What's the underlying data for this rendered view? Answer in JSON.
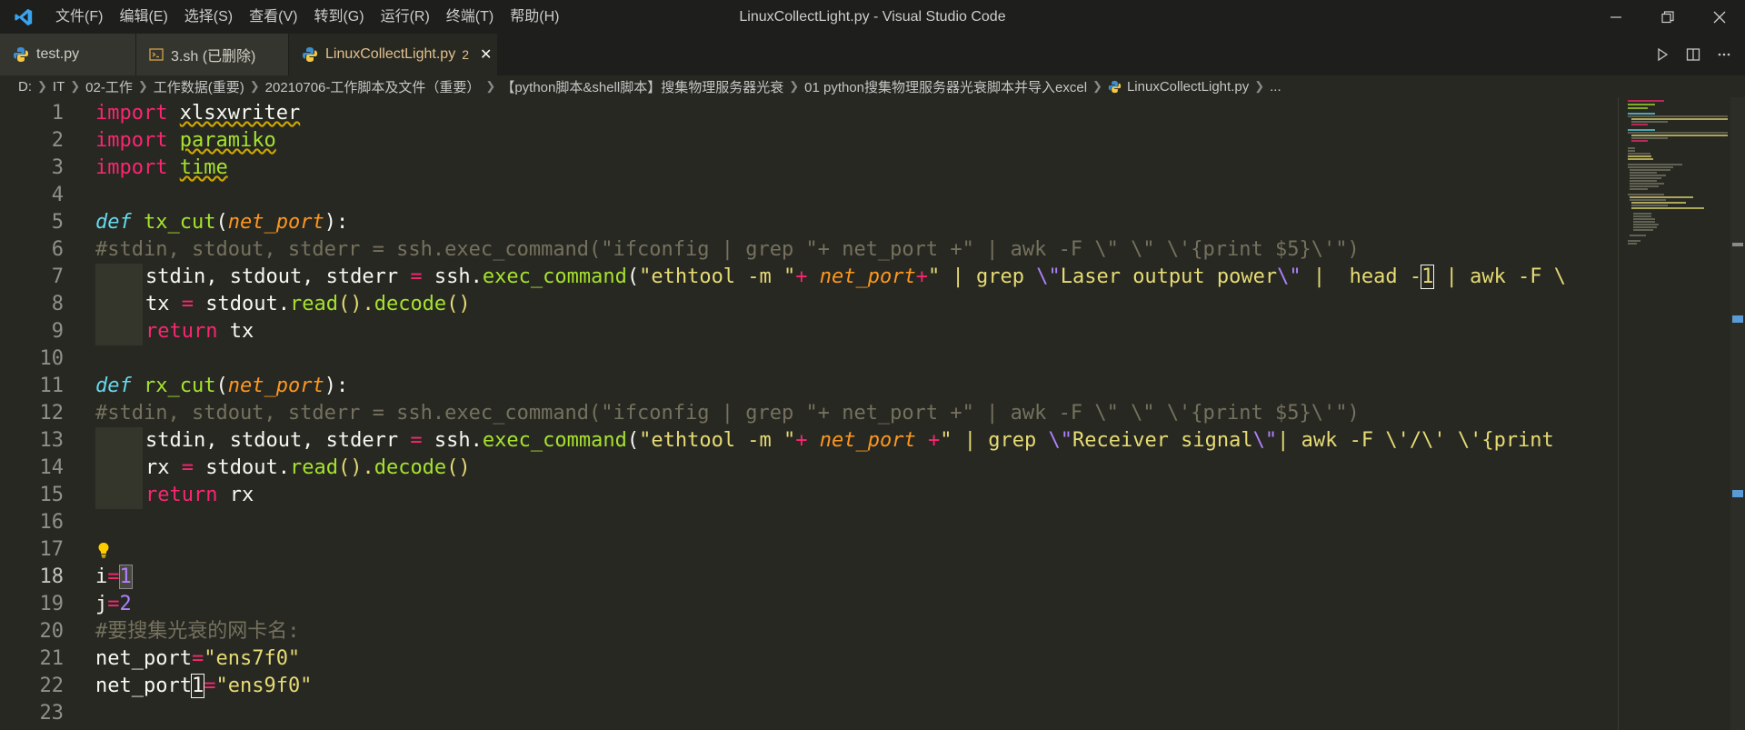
{
  "window": {
    "title": "LinuxCollectLight.py - Visual Studio Code",
    "menu": [
      "文件(F)",
      "编辑(E)",
      "选择(S)",
      "查看(V)",
      "转到(G)",
      "运行(R)",
      "终端(T)",
      "帮助(H)"
    ]
  },
  "tabs": [
    {
      "label": "test.py",
      "icon": "python-icon",
      "active": false
    },
    {
      "label": "3.sh (已删除)",
      "icon": "terminal-icon",
      "active": false
    },
    {
      "label": "LinuxCollectLight.py",
      "icon": "python-icon",
      "active": true,
      "problems": "2"
    }
  ],
  "breadcrumb": [
    "D:",
    "IT",
    "02-工作",
    "工作数据(重要)",
    "20210706-工作脚本及文件（重要）",
    "【python脚本&shell脚本】搜集物理服务器光衰",
    "01 python搜集物理服务器光衰脚本并导入excel",
    "LinuxCollectLight.py",
    "..."
  ],
  "editor": {
    "line_numbers": [
      "1",
      "2",
      "3",
      "4",
      "5",
      "6",
      "7",
      "8",
      "9",
      "10",
      "11",
      "12",
      "13",
      "14",
      "15",
      "16",
      "17",
      "18",
      "19",
      "20",
      "21",
      "22",
      "23"
    ],
    "current_line": 18,
    "code": {
      "l1_kw": "import",
      "l1_mod": "xlsxwriter",
      "l2_kw": "import",
      "l2_mod": "paramiko",
      "l3_kw": "import",
      "l3_mod": "time",
      "l5_def": "def",
      "l5_fn": "tx_cut",
      "l5_p1": "(",
      "l5_param": "net_port",
      "l5_p2": "):",
      "l6_cm": "#stdin, stdout, stderr = ssh.exec_command(\"ifconfig | grep \"+ net_port +\" | awk -F \\\" \\\" \\'{print $5}\\'\")",
      "l7_a": "stdin, stdout, stderr ",
      "l7_eq": "=",
      "l7_b": " ssh.",
      "l7_fn": "exec_command",
      "l7_paren": "(",
      "l7_s1": "\"ethtool -m \"",
      "l7_plus1": "+ ",
      "l7_param": "net_port",
      "l7_plus2": "+",
      "l7_s2": "\" | grep ",
      "l7_e1": "\\\"",
      "l7_s3": "Laser output power",
      "l7_e2": "\\\"",
      "l7_s4": " |  head -",
      "l7_s5": "1",
      "l7_s6": " | awk -F \\",
      "l8_a": "tx ",
      "l8_eq": "=",
      "l8_b": " stdout.",
      "l8_fn1": "read",
      "l8_c": "().",
      "l8_fn2": "decode",
      "l8_d": "()",
      "l9_kw": "return",
      "l9_b": " tx",
      "l11_def": "def",
      "l11_fn": "rx_cut",
      "l11_p1": "(",
      "l11_param": "net_port",
      "l11_p2": "):",
      "l12_cm": "#stdin, stdout, stderr = ssh.exec_command(\"ifconfig | grep \"+ net_port +\" | awk -F \\\" \\\" \\'{print $5}\\'\")",
      "l13_a": "stdin, stdout, stderr ",
      "l13_eq": "=",
      "l13_b": " ssh.",
      "l13_fn": "exec_command",
      "l13_paren": "(",
      "l13_s1": "\"ethtool -m \"",
      "l13_plus1": "+ ",
      "l13_param": "net_port",
      "l13_plus2": " +",
      "l13_s2": "\" | grep ",
      "l13_e1": "\\\"",
      "l13_s3": "Receiver signal",
      "l13_e2": "\\\"",
      "l13_s4": "| awk -F \\'/\\' \\'{print",
      "l14_a": "rx ",
      "l14_eq": "=",
      "l14_b": " stdout.",
      "l14_fn1": "read",
      "l14_c": "().",
      "l14_fn2": "decode",
      "l14_d": "()",
      "l15_kw": "return",
      "l15_b": " rx",
      "l18_a": "i",
      "l18_eq": "=",
      "l18_num": "1",
      "l19_a": "j",
      "l19_eq": "=",
      "l19_num": "2",
      "l20_cm": "#要搜集光衰的网卡名:",
      "l21_a": "net_port",
      "l21_eq": "=",
      "l21_str": "\"ens7f0\"",
      "l22_a": "net_port",
      "l22_b": "1",
      "l22_eq": "=",
      "l22_str": "\"ens9f0\""
    }
  },
  "colors": {
    "background": "#272822",
    "keyword": "#f92672",
    "function": "#a6e22e",
    "string": "#e6db74",
    "comment": "#75715e",
    "number": "#ae81ff",
    "storage": "#66d9ef",
    "parameter": "#fd971f"
  }
}
